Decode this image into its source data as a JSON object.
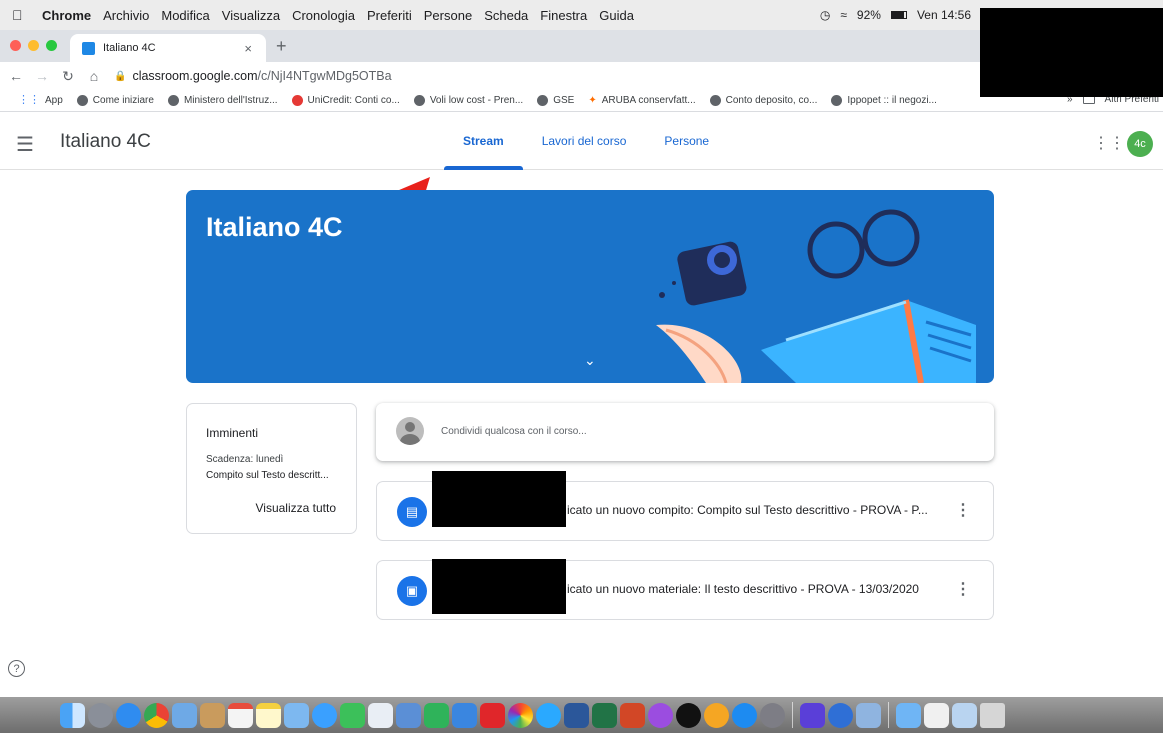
{
  "menubar": {
    "app": "Chrome",
    "items": [
      "Archivio",
      "Modifica",
      "Visualizza",
      "Cronologia",
      "Preferiti",
      "Persone",
      "Scheda",
      "Finestra",
      "Guida"
    ],
    "battery": "92%",
    "clock": "Ven 14:56"
  },
  "browser": {
    "tab_title": "Italiano 4C",
    "tab_close": "×",
    "new_tab": "+",
    "url_host": "classroom.google.com",
    "url_path": "/c/NjI4NTgwMDg5OTBa",
    "bookmarks": [
      {
        "label": "App",
        "icon": "apps-grid-icon"
      },
      {
        "label": "Come iniziare",
        "icon": "globe-icon"
      },
      {
        "label": "Ministero dell'Istruz...",
        "icon": "globe-icon"
      },
      {
        "label": "UniCredit: Conti co...",
        "icon": "unicredit-icon"
      },
      {
        "label": "Voli low cost - Pren...",
        "icon": "globe-icon"
      },
      {
        "label": "GSE",
        "icon": "globe-icon"
      },
      {
        "label": "ARUBA conservfatt...",
        "icon": "aruba-icon"
      },
      {
        "label": "Conto deposito, co...",
        "icon": "globe-icon"
      },
      {
        "label": "Ippopet :: il negozi...",
        "icon": "globe-icon"
      }
    ],
    "bookmarks_more": "»",
    "other_bookmarks": "Altri Preferiti"
  },
  "classroom": {
    "course_title": "Italiano 4C",
    "tabs": [
      {
        "label": "Stream",
        "active": true
      },
      {
        "label": "Lavori del corso",
        "active": false
      },
      {
        "label": "Persone",
        "active": false
      }
    ],
    "avatar_initials": "4c",
    "banner_title": "Italiano 4C",
    "upcoming": {
      "title": "Imminenti",
      "due": "Scadenza: lunedì",
      "item": "Compito sul Testo descritt...",
      "view_all": "Visualizza tutto"
    },
    "share_placeholder": "Condividi qualcosa con il corso...",
    "posts": [
      {
        "text": "icato un nuovo compito: Compito sul Testo descrittivo - PROVA - P...",
        "icon": "assignment-icon"
      },
      {
        "text": "icato un nuovo materiale: Il testo descrittivo - PROVA - 13/03/2020",
        "icon": "material-icon"
      }
    ],
    "help": "?"
  },
  "colors": {
    "accent": "#1967d2",
    "banner": "#1a73c9",
    "avatar": "#4caf50",
    "annotation_arrow": "#e8211b"
  }
}
